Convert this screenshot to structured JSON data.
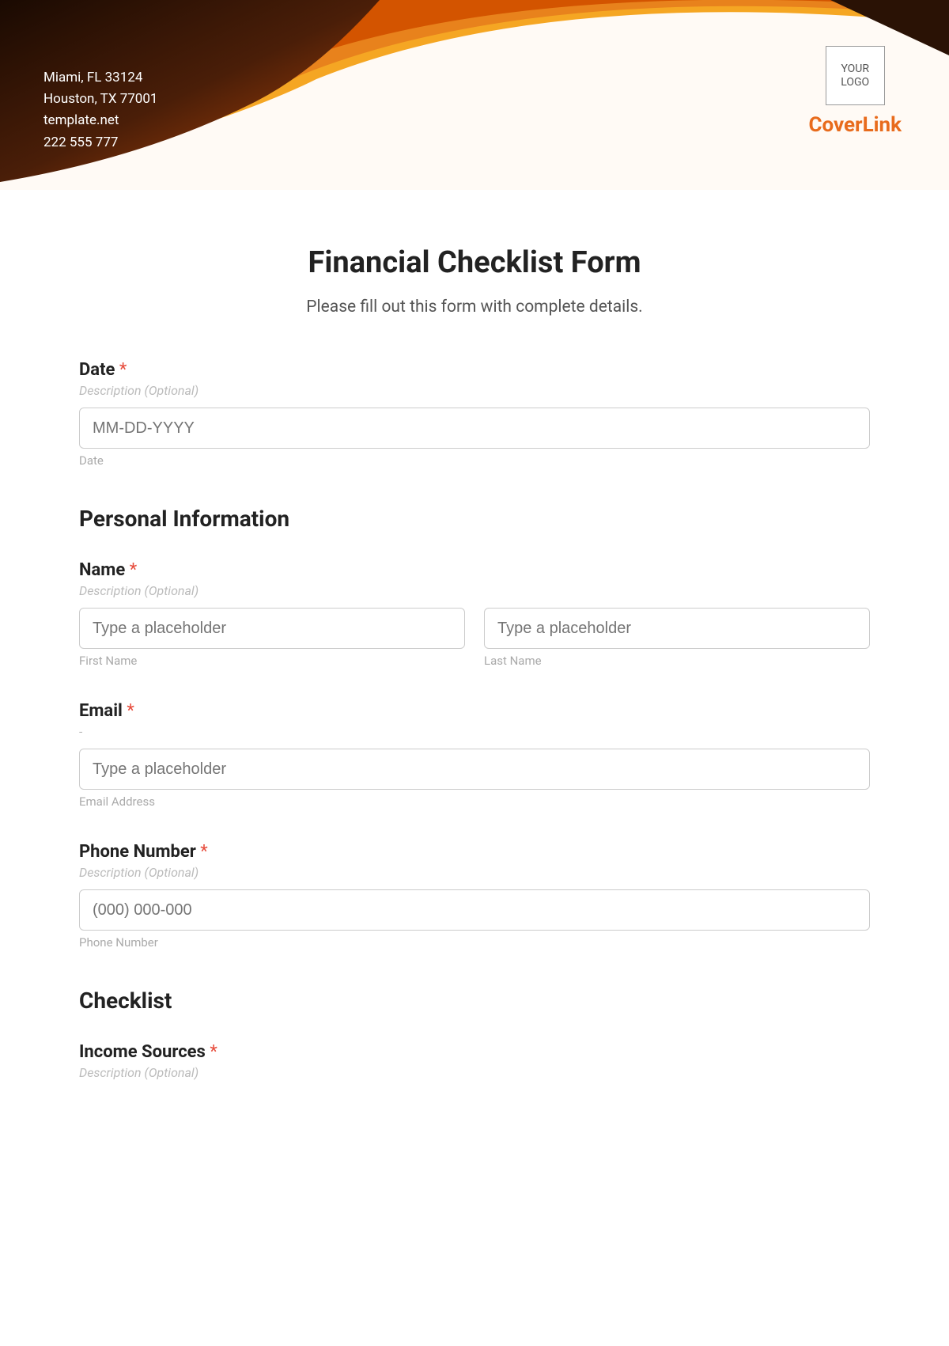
{
  "header": {
    "contact": {
      "line1": "Miami, FL 33124",
      "line2": "Houston, TX 77001",
      "line3": "template.net",
      "line4": "222 555 777"
    },
    "logo_text": "YOUR LOGO",
    "brand": "CoverLink"
  },
  "form": {
    "title": "Financial Checklist Form",
    "subtitle": "Please fill out this form with complete details.",
    "required_mark": "*",
    "date": {
      "label": "Date",
      "description": "Description (Optional)",
      "placeholder": "MM-DD-YYYY",
      "sublabel": "Date"
    },
    "personal_info": {
      "title": "Personal Information",
      "name": {
        "label": "Name",
        "description": "Description (Optional)",
        "first_placeholder": "Type a placeholder",
        "last_placeholder": "Type a placeholder",
        "first_sublabel": "First Name",
        "last_sublabel": "Last Name"
      },
      "email": {
        "label": "Email",
        "description": "-",
        "placeholder": "Type a placeholder",
        "sublabel": "Email Address"
      },
      "phone": {
        "label": "Phone Number",
        "description": "Description (Optional)",
        "placeholder": "(000) 000-000",
        "sublabel": "Phone Number"
      }
    },
    "checklist": {
      "title": "Checklist",
      "income": {
        "label": "Income Sources",
        "description": "Description (Optional)"
      }
    }
  }
}
